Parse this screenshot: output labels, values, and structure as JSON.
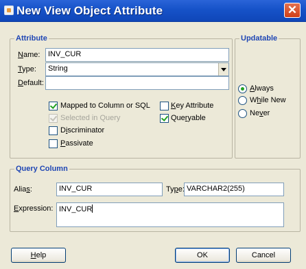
{
  "window": {
    "title": "New View Object Attribute",
    "close_glyph": "✕"
  },
  "attribute_group": {
    "legend": "Attribute",
    "name": {
      "label_key": "N",
      "label_rest": "ame:",
      "value": "INV_CUR"
    },
    "type": {
      "label_key": "T",
      "label_rest": "ype:",
      "value": "String"
    },
    "default": {
      "label_key": "D",
      "label_rest": "efault:",
      "value": ""
    },
    "checkboxes": {
      "mapped": {
        "label": "Mapped to Column or SQL",
        "checked": true,
        "enabled": true
      },
      "selected_in_query": {
        "label": "Selected in Query",
        "checked": true,
        "enabled": false
      },
      "discriminator": {
        "label_pre": "D",
        "label_key": "i",
        "label_rest": "scriminator",
        "checked": false,
        "enabled": true
      },
      "passivate": {
        "label_key": "P",
        "label_rest": "assivate",
        "checked": false,
        "enabled": true
      },
      "key_attribute": {
        "label_key": "K",
        "label_rest": "ey Attribute",
        "checked": false,
        "enabled": true
      },
      "queryable": {
        "label_pre": "Que",
        "label_key": "r",
        "label_rest": "yable",
        "checked": true,
        "enabled": true
      }
    }
  },
  "updatable_group": {
    "legend": "Updatable",
    "options": {
      "always": {
        "label_key": "A",
        "label_rest": "lways",
        "selected": true
      },
      "while_new": {
        "label_pre": "W",
        "label_key": "h",
        "label_rest": "ile New",
        "selected": false
      },
      "never": {
        "label_pre": "Ne",
        "label_key": "v",
        "label_rest": "er",
        "selected": false
      }
    }
  },
  "query_column_group": {
    "legend": "Query Column",
    "alias": {
      "label_pre": "Alia",
      "label_key": "s",
      "label_rest": ":",
      "value": "INV_CUR"
    },
    "type": {
      "label_pre": "Ty",
      "label_key": "p",
      "label_rest": "e:",
      "value": "VARCHAR2(255)"
    },
    "expression": {
      "label_key": "E",
      "label_rest": "xpression:",
      "value": "INV_CUR"
    }
  },
  "buttons": {
    "help": {
      "label_key": "H",
      "label_rest": "elp"
    },
    "ok": {
      "label": "OK"
    },
    "cancel": {
      "label": "Cancel"
    }
  }
}
